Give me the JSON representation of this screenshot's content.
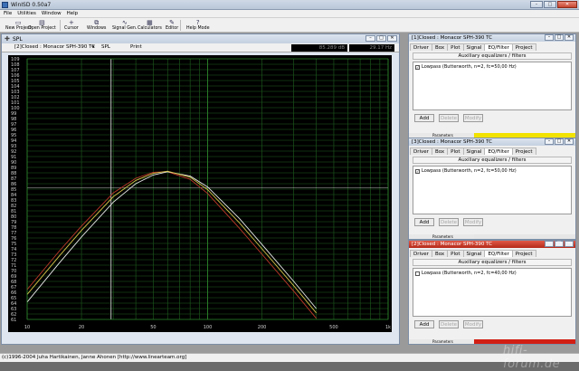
{
  "app": {
    "title": "WinISD 0.50a7"
  },
  "menu": [
    "File",
    "Utilities",
    "Window",
    "Help"
  ],
  "toolbar": [
    {
      "label": "New Project",
      "icon": "new-project-icon"
    },
    {
      "label": "Open Project",
      "icon": "open-project-icon"
    },
    {
      "label": "Cursor",
      "icon": "cursor-icon"
    },
    {
      "label": "Windows",
      "icon": "windows-icon"
    },
    {
      "label": "Signal Gen.",
      "icon": "signal-gen-icon"
    },
    {
      "label": "Calculators",
      "icon": "calculator-icon"
    },
    {
      "label": "Editor",
      "icon": "editor-icon"
    },
    {
      "label": "Help Mode",
      "icon": "help-icon"
    }
  ],
  "spl": {
    "title": "SPL",
    "driver": "[2]Closed : Monacor SPH-390 TC",
    "mode": "SPL",
    "print": "Print",
    "readout_db": "85.289 dB",
    "readout_hz": "29.17 Hz"
  },
  "chart_data": {
    "type": "line",
    "xscale": "log",
    "xlim": [
      10,
      1000
    ],
    "ylim": [
      61,
      109
    ],
    "x_tick_labels": [
      {
        "v": 10,
        "t": "10"
      },
      {
        "v": 20,
        "t": "20"
      },
      {
        "v": 50,
        "t": "50"
      },
      {
        "v": 100,
        "t": "100"
      },
      {
        "v": 200,
        "t": "200"
      },
      {
        "v": 500,
        "t": "500"
      },
      {
        "v": 1000,
        "t": "1k"
      }
    ],
    "series": [
      {
        "color": "#c0392b",
        "x": [
          10,
          15,
          20,
          30,
          40,
          50,
          60,
          80,
          100,
          150,
          200,
          300,
          400
        ],
        "y": [
          66.5,
          73.5,
          78.2,
          84.3,
          87.0,
          88.1,
          88.2,
          86.8,
          84.2,
          77.8,
          73.0,
          66.2,
          61.2
        ]
      },
      {
        "color": "#e8e8e8",
        "x": [
          10,
          15,
          20,
          30,
          40,
          50,
          60,
          80,
          100,
          150,
          200,
          300,
          400
        ],
        "y": [
          64.2,
          71.3,
          76.2,
          82.6,
          86.0,
          87.6,
          88.2,
          87.4,
          85.4,
          79.6,
          74.8,
          68.0,
          63.0
        ]
      },
      {
        "color": "#d6c34a",
        "x": [
          10,
          15,
          20,
          30,
          40,
          50,
          60,
          80,
          100,
          150,
          200,
          300,
          400
        ],
        "y": [
          65.6,
          72.6,
          77.4,
          83.6,
          86.6,
          87.9,
          88.3,
          87.2,
          84.9,
          78.8,
          74.0,
          67.2,
          62.2
        ]
      }
    ],
    "cursor": {
      "x": 29.17,
      "y": 85.289
    },
    "grid": true
  },
  "panels": [
    {
      "title": "[1]Closed : Monacor SPH-390 TC",
      "tabs": [
        "Driver",
        "Box",
        "Plot",
        "Signal",
        "EQ/Filter",
        "Project"
      ],
      "active_tab": "EQ/Filter",
      "aux": "Auxiliary equalizers / filters",
      "filter": "Lowpass (Butterworth, n=2, fc=50,00 Hz)",
      "checked": true,
      "buttons": {
        "add": "Add",
        "delete": "Delete",
        "modify": "Modify"
      },
      "param_label": "Parameters",
      "bar_color": "#f2e200"
    },
    {
      "title": "[3]Closed : Monacor SPH-390 TC",
      "tabs": [
        "Driver",
        "Box",
        "Plot",
        "Signal",
        "EQ/Filter",
        "Project"
      ],
      "active_tab": "EQ/Filter",
      "aux": "Auxiliary equalizers / filters",
      "filter": "Lowpass (Butterworth, n=2, fc=50,00 Hz)",
      "checked": true,
      "buttons": {
        "add": "Add",
        "delete": "Delete",
        "modify": "Modify"
      },
      "param_label": "Parameters",
      "bar_color": "#e6e6e6"
    },
    {
      "title": "[2]Closed : Monacor SPH-390 TC",
      "tabs": [
        "Driver",
        "Box",
        "Plot",
        "Signal",
        "EQ/Filter",
        "Project"
      ],
      "active_tab": "EQ/Filter",
      "aux": "Auxiliary equalizers / filters",
      "filter": "Lowpass (Butterworth, n=2, fc=40,00 Hz)",
      "checked": false,
      "buttons": {
        "add": "Add",
        "delete": "Delete",
        "modify": "Modify"
      },
      "param_label": "Parameters",
      "bar_color": "#d21f14"
    }
  ],
  "status": "(c)1996-2004 Juha Hartikainen, Janne Ahonen [http://www.linearteam.org]",
  "watermark": "hifi-forum.de"
}
